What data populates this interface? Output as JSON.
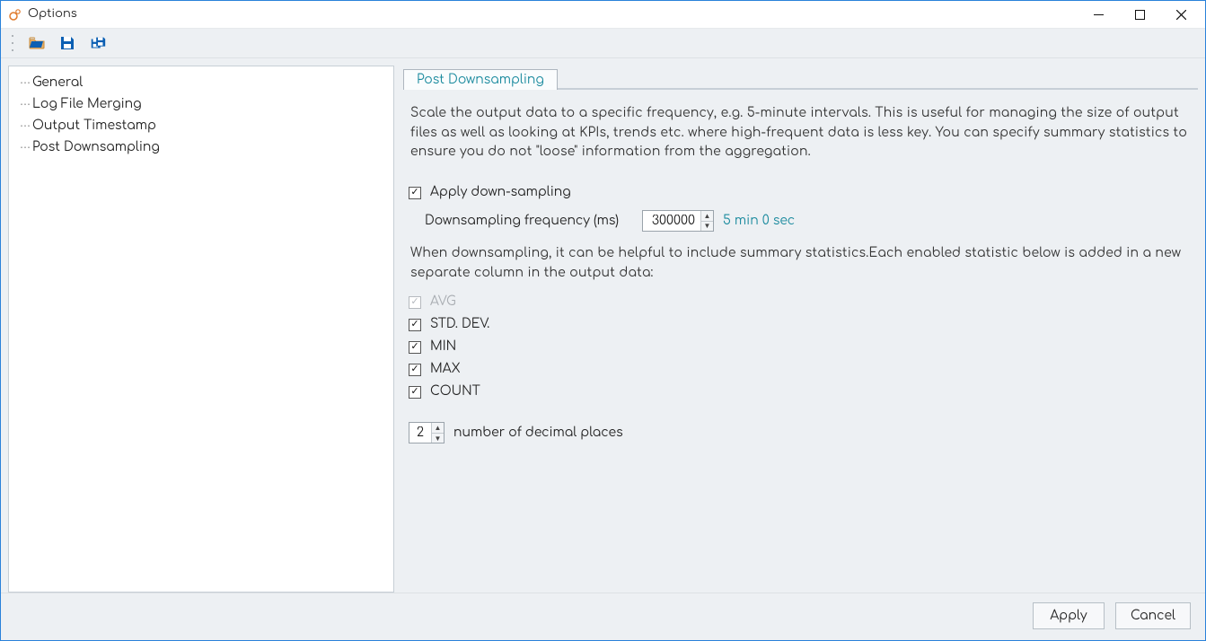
{
  "window": {
    "title": "Options"
  },
  "sidebar": {
    "items": [
      {
        "label": "General"
      },
      {
        "label": "Log File Merging"
      },
      {
        "label": "Output Timestamp"
      },
      {
        "label": "Post Downsampling"
      }
    ]
  },
  "tab": {
    "label": "Post Downsampling"
  },
  "panel": {
    "description": "Scale the output data to a specific frequency, e.g. 5-minute intervals. This is useful for managing the size of output files as well as looking at KPIs, trends etc. where high-frequent data is less key. You can specify summary statistics to ensure you do not \"loose\" information from the aggregation.",
    "apply_label": "Apply down-sampling",
    "apply_checked": true,
    "freq_label": "Downsampling frequency (ms)",
    "freq_value": "300000",
    "freq_hint": "5 min 0 sec",
    "stats_intro": "When downsampling, it can be helpful to include summary statistics.Each enabled statistic below is added in a new separate column in the output data:",
    "stats": [
      {
        "label": "AVG",
        "checked": true,
        "disabled": true
      },
      {
        "label": "STD. DEV.",
        "checked": true,
        "disabled": false
      },
      {
        "label": "MIN",
        "checked": true,
        "disabled": false
      },
      {
        "label": "MAX",
        "checked": true,
        "disabled": false
      },
      {
        "label": "COUNT",
        "checked": true,
        "disabled": false
      }
    ],
    "decimals_value": "2",
    "decimals_label": "number of decimal places"
  },
  "footer": {
    "apply": "Apply",
    "cancel": "Cancel"
  }
}
